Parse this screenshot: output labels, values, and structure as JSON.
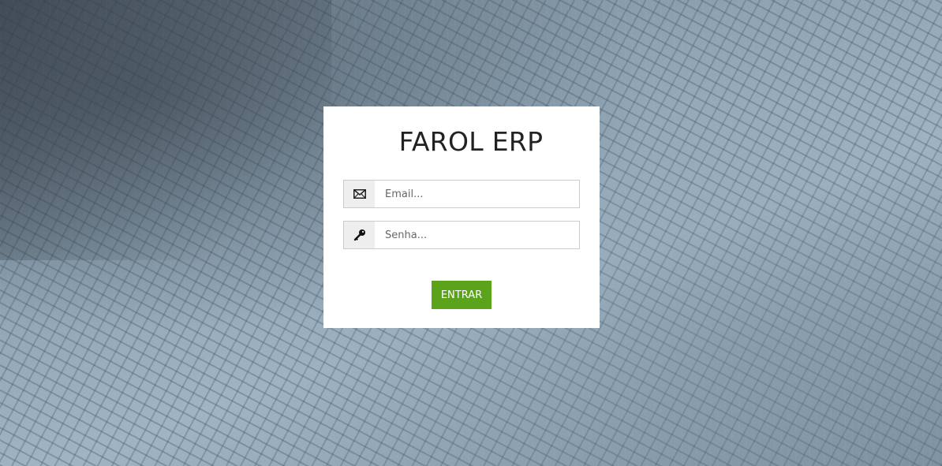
{
  "login": {
    "title": "FAROL ERP",
    "email": {
      "value": "",
      "placeholder": "Email...",
      "icon": "envelope-icon"
    },
    "password": {
      "value": "",
      "placeholder": "Senha...",
      "icon": "key-icon"
    },
    "submit_label": "ENTRAR"
  },
  "colors": {
    "button": "#5aa31a",
    "card": "#ffffff",
    "addon": "#eeeeee",
    "border": "#cccccc"
  }
}
